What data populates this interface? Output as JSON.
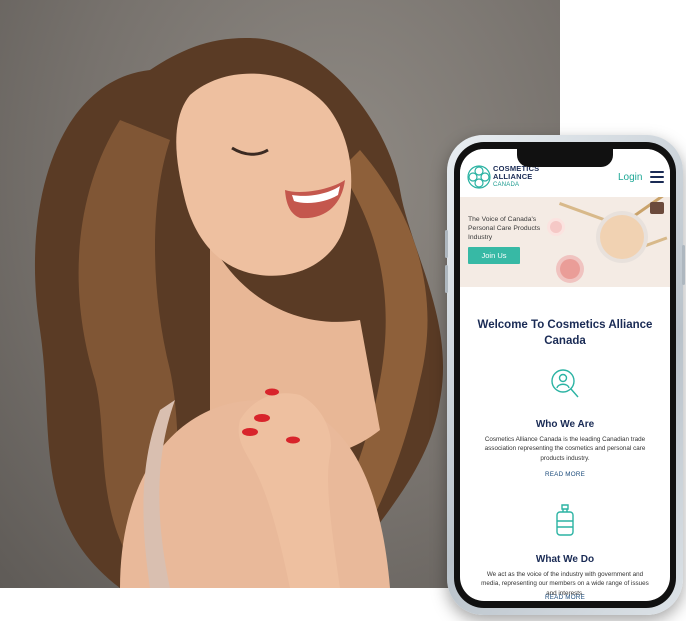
{
  "header": {
    "brand_line1": "COSMETICS",
    "brand_line2": "ALLIANCE",
    "brand_line3": "CANADA",
    "login_label": "Login"
  },
  "hero": {
    "tagline": "The Voice of Canada's Personal Care Products Industry",
    "join_label": "Join Us"
  },
  "main": {
    "welcome_title": "Welcome To Cosmetics Alliance Canada",
    "sections": [
      {
        "title": "Who We Are",
        "text": "Cosmetics Alliance Canada is the leading Canadian trade association representing the cosmetics and personal care products industry.",
        "link": "READ MORE",
        "icon": "person-search-icon"
      },
      {
        "title": "What We Do",
        "text": "We act as the voice of the industry with government and media, representing our members on a wide range of issues and interests.",
        "link": "READ MORE",
        "icon": "bottle-icon"
      }
    ]
  },
  "colors": {
    "teal": "#37b9a5",
    "navy": "#1a2b55",
    "hero_bg": "#f4ebe4"
  }
}
